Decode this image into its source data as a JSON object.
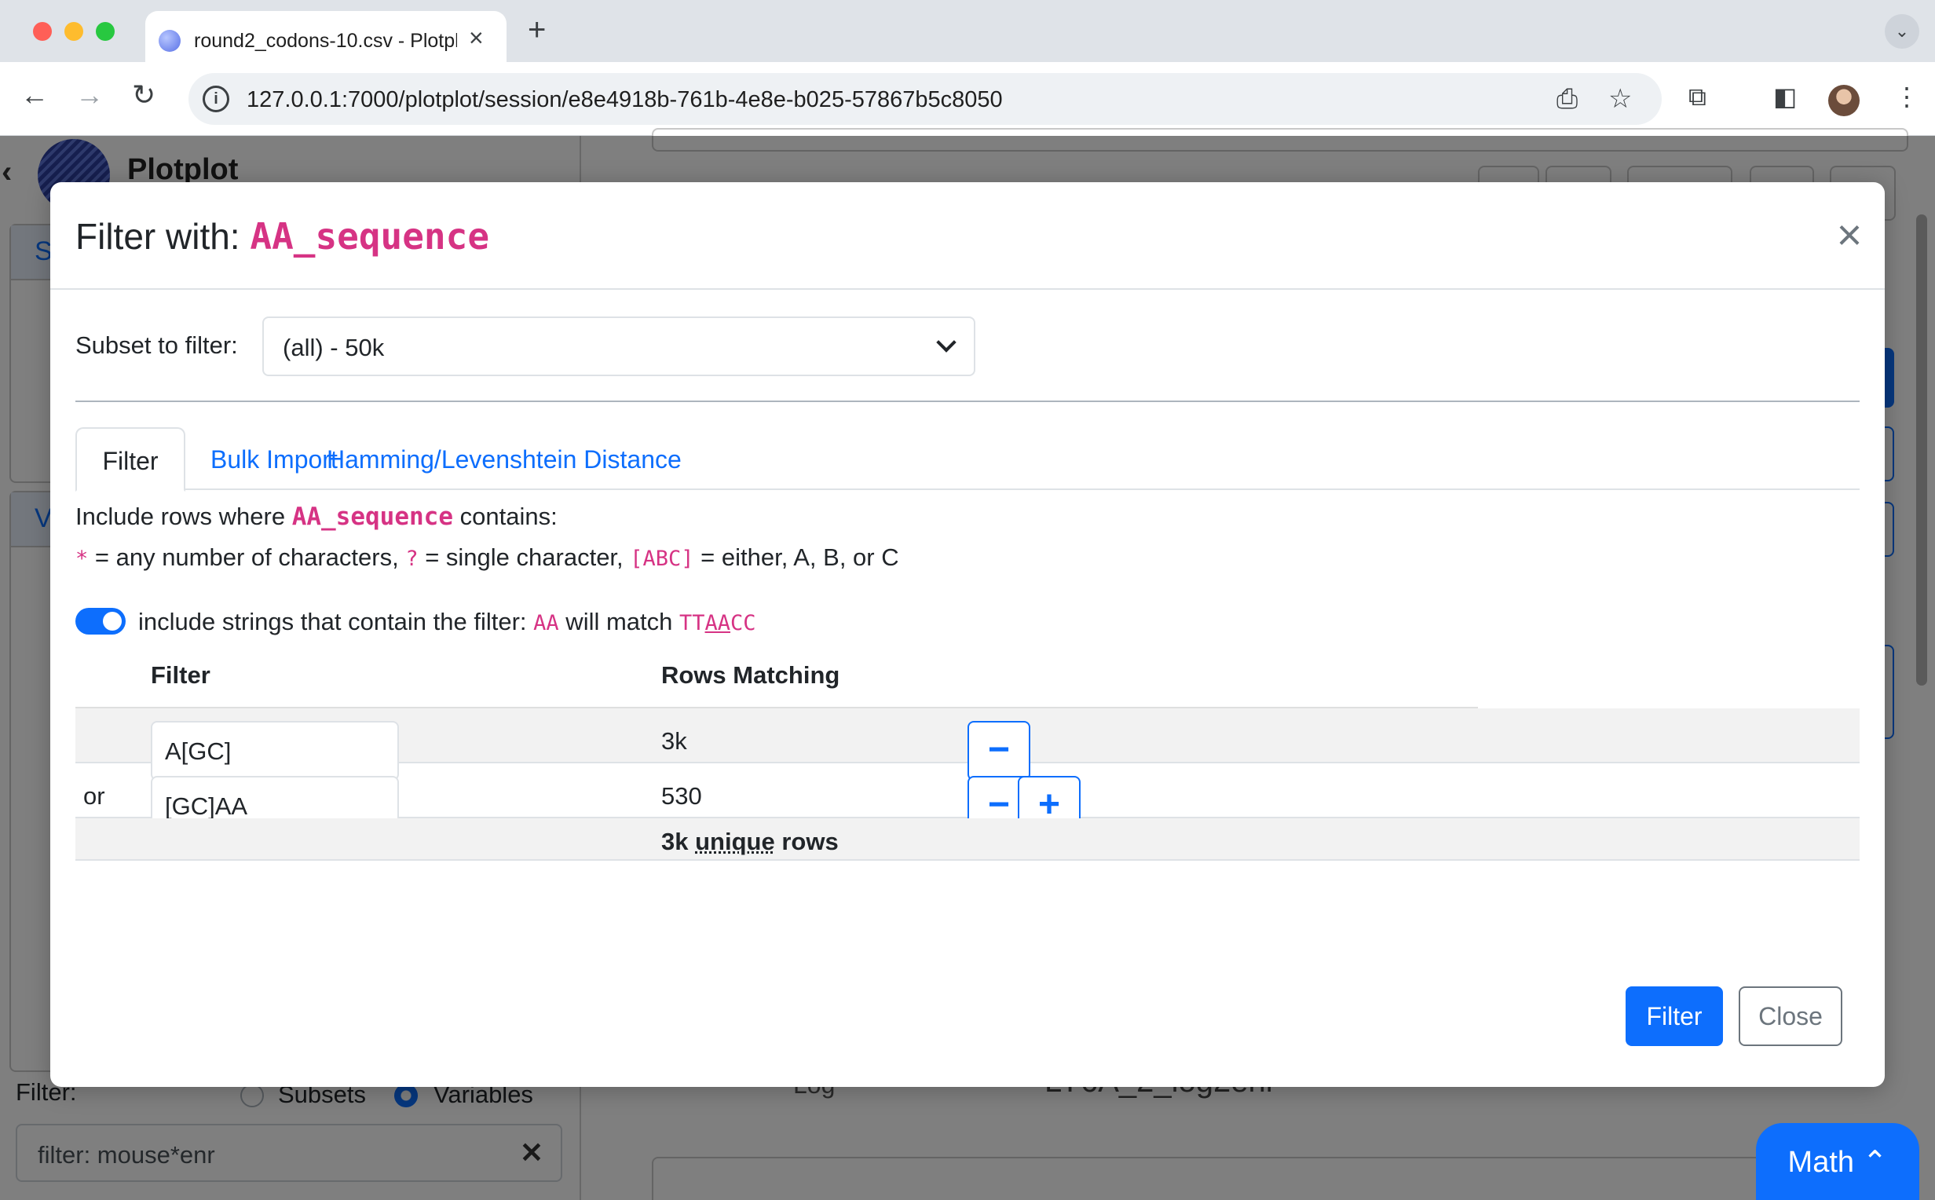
{
  "browser": {
    "tab_title": "round2_codons-10.csv - Plotplot",
    "tab_close": "×",
    "new_tab": "+",
    "url": "127.0.0.1:7000/plotplot/session/e8e4918b-761b-4e8e-b025-57867b5c8050"
  },
  "app": {
    "brand": "Plotplot",
    "sidebar_card_letter_1": "S",
    "sidebar_card_letter_2": "V",
    "filter_label": "Filter:",
    "radio_subsets": "Subsets",
    "radio_variables": "Variables",
    "radio_selected": "Variables",
    "search_value": "filter: mouse*enr",
    "bg_log_label": "Log",
    "bg_variable": "LY6A_2_log2enr",
    "math_button": "Math"
  },
  "modal": {
    "title_prefix": "Filter with: ",
    "column": "AA_sequence",
    "close_symbol": "×",
    "subset_label": "Subset to filter:",
    "subset_value": "(all) - 50k",
    "tabs": [
      {
        "label": "Filter",
        "active": true
      },
      {
        "label": "Bulk Import",
        "active": false
      },
      {
        "label": "Hamming/Levenshtein Distance",
        "active": false
      }
    ],
    "desc_prefix": "Include rows where ",
    "desc_suffix": " contains:",
    "help": {
      "star": "*",
      "star_text": " = any number of characters, ",
      "q": "?",
      "q_text": " = single character, ",
      "set": "[ABC]",
      "set_text": " = either, A, B, or C"
    },
    "toggle": {
      "on": true,
      "text": "include strings that contain the filter: ",
      "example": "AA",
      "middle": " will match ",
      "match_pre": "TT",
      "match_hl": "AA",
      "match_post": "CC"
    },
    "table": {
      "headers": [
        "Filter",
        "Rows Matching"
      ],
      "rows": [
        {
          "prefix": "",
          "filter": "A[GC]",
          "count": "3k"
        },
        {
          "prefix": "or",
          "filter": "[GC]AA",
          "count": "530"
        }
      ],
      "total_prefix": "3k ",
      "total_unique": "unique",
      "total_suffix": " rows",
      "minus": "−",
      "plus": "+"
    },
    "filter_button": "Filter",
    "close_button": "Close"
  },
  "colors": {
    "primary": "#0d6efd",
    "code_pink": "#d63384",
    "stripe": "#f2f2f2"
  }
}
